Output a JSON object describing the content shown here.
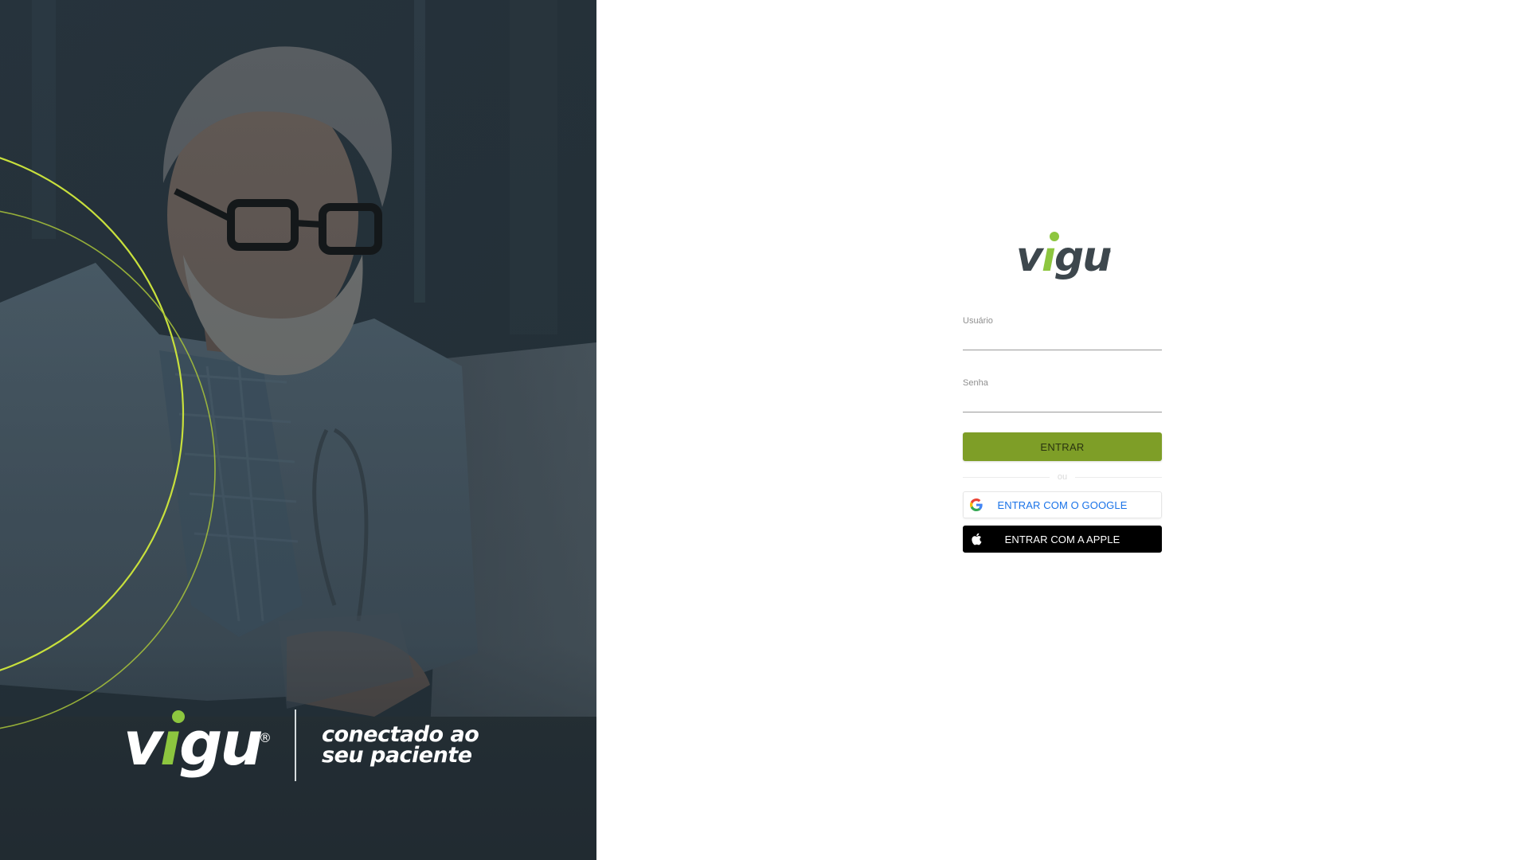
{
  "hero": {
    "brand_name": "vigu",
    "registered_mark": "®",
    "tagline_line1": "conectado ao",
    "tagline_line2": "seu paciente"
  },
  "login": {
    "brand_name": "vigu",
    "registered_mark": "®",
    "username": {
      "label": "Usuário",
      "value": ""
    },
    "password": {
      "label": "Senha",
      "value": ""
    },
    "submit_label": "ENTRAR",
    "or_label": "ou",
    "google_label": "ENTRAR COM O GOOGLE",
    "apple_label": "ENTRAR COM A APPLE",
    "google_icon": "google-g-icon",
    "apple_icon": "apple-icon"
  },
  "colors": {
    "brand_green": "#8dc63f",
    "button_green": "#7e9e27",
    "logo_gray": "#3d474d",
    "google_blue": "#1a73e8",
    "hero_arc": "#c8e03c"
  }
}
